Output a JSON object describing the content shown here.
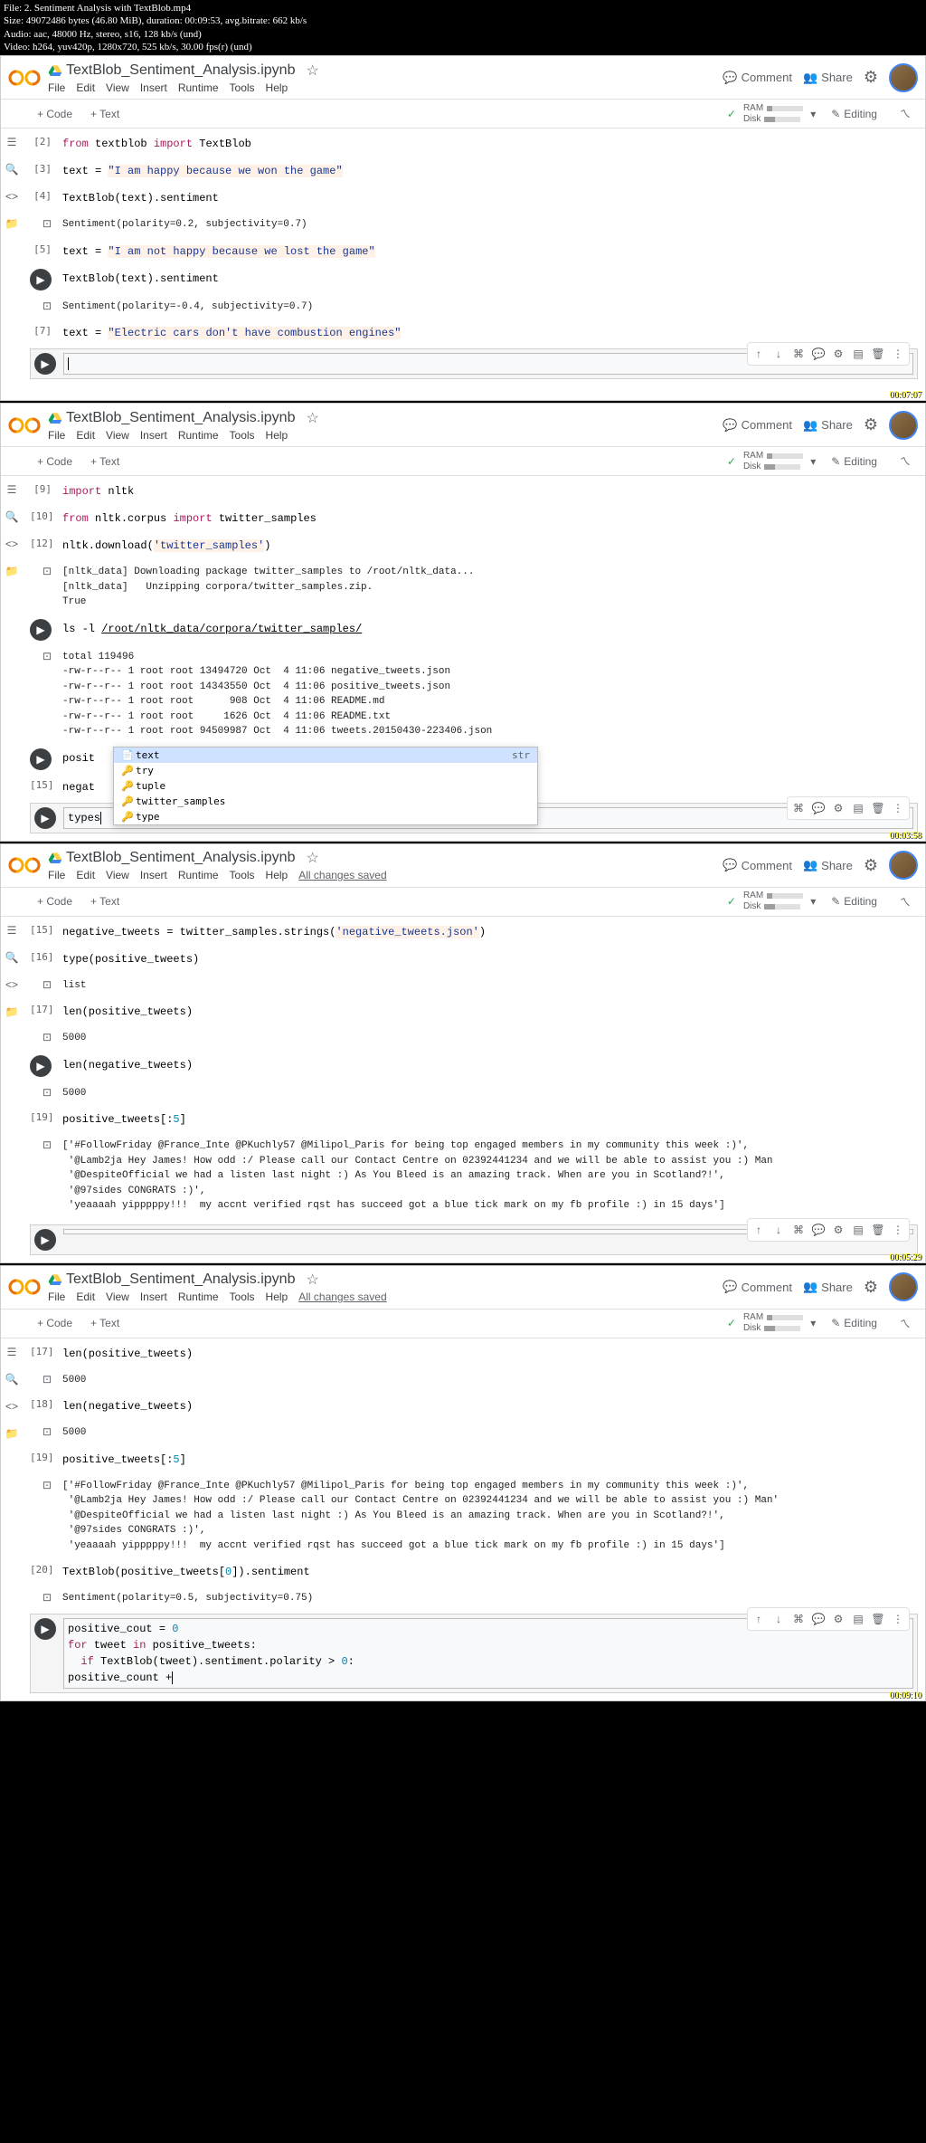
{
  "video_info": {
    "file": "File: 2. Sentiment Analysis with TextBlob.mp4",
    "size": "Size: 49072486 bytes (46.80 MiB), duration: 00:09:53, avg.bitrate: 662 kb/s",
    "audio": "Audio: aac, 48000 Hz, stereo, s16, 128 kb/s (und)",
    "video": "Video: h264, yuv420p, 1280x720, 525 kb/s, 30.00 fps(r) (und)"
  },
  "header": {
    "title": "TextBlob_Sentiment_Analysis.ipynb",
    "comment": "Comment",
    "share": "Share"
  },
  "menu": {
    "file": "File",
    "edit": "Edit",
    "view": "View",
    "insert": "Insert",
    "runtime": "Runtime",
    "tools": "Tools",
    "help": "Help",
    "saved": "All changes saved"
  },
  "toolbar": {
    "code": "+ Code",
    "text": "+ Text",
    "ram": "RAM",
    "disk": "Disk",
    "editing": "Editing"
  },
  "window1": {
    "timestamp": "00:07:07",
    "cells": [
      {
        "marker": "[2]",
        "type": "code",
        "parts": [
          {
            "t": "kw",
            "v": "from"
          },
          {
            "t": "sp"
          },
          {
            "t": "txt",
            "v": "textblob"
          },
          {
            "t": "sp"
          },
          {
            "t": "kw",
            "v": "import"
          },
          {
            "t": "sp"
          },
          {
            "t": "txt",
            "v": "TextBlob"
          }
        ]
      },
      {
        "marker": "[3]",
        "type": "code",
        "text": "text = ",
        "str": "\"I am happy because we won the game\""
      },
      {
        "marker": "[4]",
        "type": "code",
        "text": "TextBlob(text).sentiment"
      },
      {
        "marker": "",
        "type": "output",
        "text": "Sentiment(polarity=0.2, subjectivity=0.7)"
      },
      {
        "marker": "[5]",
        "type": "code",
        "text": "text = ",
        "str": "\"I am not happy because we lost the game\""
      },
      {
        "marker": "",
        "type": "code-play",
        "text": "TextBlob(text).sentiment"
      },
      {
        "marker": "",
        "type": "output",
        "text": "Sentiment(polarity=-0.4, subjectivity=0.7)"
      },
      {
        "marker": "[7]",
        "type": "code",
        "text": "text = ",
        "str": "\"Electric cars don't have combustion engines\""
      },
      {
        "marker": "",
        "type": "active-play",
        "text": ""
      }
    ]
  },
  "window2": {
    "timestamp": "00:03:58",
    "cells": {
      "c9": "[9]",
      "c9_import": "import",
      "c9_nltk": " nltk",
      "c10": "[10]",
      "c10_from": "from",
      "c10_mod": " nltk.corpus ",
      "c10_import": "import",
      "c10_name": " twitter_samples",
      "c12": "[12]",
      "c12_text": "nltk.download(",
      "c12_str": "'twitter_samples'",
      "c12_end": ")",
      "c12_out": "[nltk_data] Downloading package twitter_samples to /root/nltk_data...\n[nltk_data]   Unzipping corpora/twitter_samples.zip.\nTrue",
      "ls_cmd": "ls -l ",
      "ls_path": "/root/nltk_data/corpora/twitter_samples/",
      "ls_out": "total 119496\n-rw-r--r-- 1 root root 13494720 Oct  4 11:06 negative_tweets.json\n-rw-r--r-- 1 root root 14343550 Oct  4 11:06 positive_tweets.json\n-rw-r--r-- 1 root root      908 Oct  4 11:06 README.md\n-rw-r--r-- 1 root root     1626 Oct  4 11:06 README.txt\n-rw-r--r-- 1 root root 94509987 Oct  4 11:06 tweets.20150430-223406.json",
      "posit": "posit",
      "c15": "[15]",
      "c15_text": "negat",
      "active_text": "types"
    },
    "autocomplete": [
      {
        "label": "text",
        "hint": "str",
        "selected": true
      },
      {
        "label": "try"
      },
      {
        "label": "tuple"
      },
      {
        "label": "twitter_samples"
      },
      {
        "label": "type"
      }
    ]
  },
  "window3": {
    "timestamp": "00:05:29",
    "cells": {
      "c15": "[15]",
      "c15_text": "negative_tweets = twitter_samples.strings(",
      "c15_str": "'negative_tweets.json'",
      "c15_end": ")",
      "c16": "[16]",
      "c16_text": "type(positive_tweets)",
      "c16_out": "list",
      "c17": "[17]",
      "c17_text": "len(positive_tweets)",
      "c17_out": "5000",
      "len_neg": "len(negative_tweets)",
      "len_neg_out": "5000",
      "c19": "[19]",
      "c19_text": "positive_tweets[:",
      "c19_num": "5",
      "c19_end": "]",
      "c19_out": "['#FollowFriday @France_Inte @PKuchly57 @Milipol_Paris for being top engaged members in my community this week :)',\n '@Lamb2ja Hey James! How odd :/ Please call our Contact Centre on 02392441234 and we will be able to assist you :) Man\n '@DespiteOfficial we had a listen last night :) As You Bleed is an amazing track. When are you in Scotland?!',\n '@97sides CONGRATS :)',\n 'yeaaaah yipppppy!!!  my accnt verified rqst has succeed got a blue tick mark on my fb profile :) in 15 days']"
    }
  },
  "window4": {
    "timestamp": "00:09:10",
    "cells": {
      "c17": "[17]",
      "c17_text": "len(positive_tweets)",
      "c17_out": "5000",
      "c18": "[18]",
      "c18_text": "len(negative_tweets)",
      "c18_out": "5000",
      "c19": "[19]",
      "c19_text": "positive_tweets[:",
      "c19_num": "5",
      "c19_end": "]",
      "c19_out": "['#FollowFriday @France_Inte @PKuchly57 @Milipol_Paris for being top engaged members in my community this week :)',\n '@Lamb2ja Hey James! How odd :/ Please call our Contact Centre on 02392441234 and we will be able to assist you :) Man'\n '@DespiteOfficial we had a listen last night :) As You Bleed is an amazing track. When are you in Scotland?!',\n '@97sides CONGRATS :)',\n 'yeaaaah yipppppy!!!  my accnt verified rqst has succeed got a blue tick mark on my fb profile :) in 15 days']",
      "c20": "[20]",
      "c20_text": "TextBlob(positive_tweets[",
      "c20_num": "0",
      "c20_end": "]).sentiment",
      "c20_out": "Sentiment(polarity=0.5, subjectivity=0.75)",
      "active_l1_a": "positive_cout = ",
      "active_l1_num": "0",
      "active_l2_for": "for",
      "active_l2_a": " tweet ",
      "active_l2_in": "in",
      "active_l2_b": " positive_tweets:",
      "active_l3_if": "if",
      "active_l3_a": " TextBlob(tweet).sentiment.polarity > ",
      "active_l3_num": "0",
      "active_l3_b": ":",
      "active_l4": "    positive_count +"
    }
  }
}
